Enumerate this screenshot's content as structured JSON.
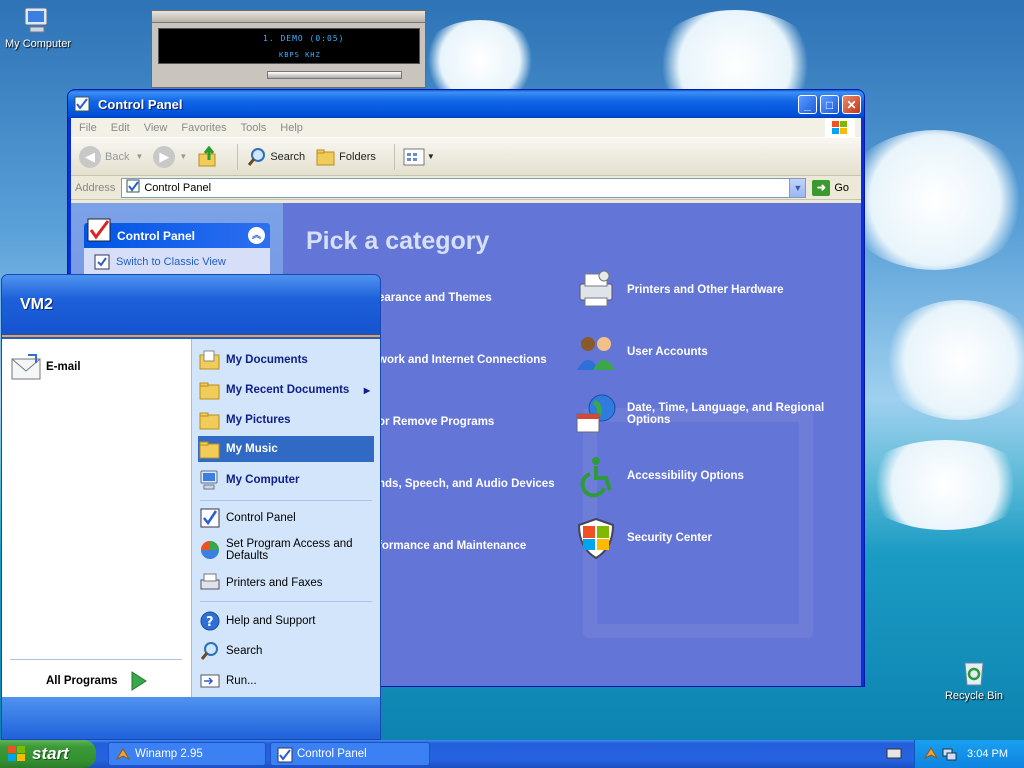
{
  "desktop": {
    "icons": [
      {
        "label": "My Computer",
        "icon": "computer-icon"
      },
      {
        "label": "Recycle Bin",
        "icon": "recycle-bin-icon"
      }
    ]
  },
  "winamp": {
    "track": "1. DEMO (0:05)",
    "kbps": "KBPS   KHZ"
  },
  "control_panel": {
    "title": "Control Panel",
    "menu": [
      "File",
      "Edit",
      "View",
      "Favorites",
      "Tools",
      "Help"
    ],
    "toolbar": {
      "back": "Back",
      "search": "Search",
      "folders": "Folders"
    },
    "address_label": "Address",
    "address_value": "Control Panel",
    "go_label": "Go",
    "left_pane": {
      "header": "Control Panel",
      "link": "Switch to Classic View"
    },
    "heading": "Pick a category",
    "categories_left": [
      "earance and Themes",
      "work and Internet Connections",
      "or Remove Programs",
      "nds, Speech, and Audio Devices",
      "formance and Maintenance"
    ],
    "categories_right": [
      "Printers and Other Hardware",
      "User Accounts",
      "Date, Time, Language, and Regional Options",
      "Accessibility Options",
      "Security Center"
    ]
  },
  "start_menu": {
    "user": "VM2",
    "pinned": [
      {
        "label": "E-mail"
      }
    ],
    "all_programs": "All Programs",
    "right_items": {
      "my_documents": "My Documents",
      "my_recent_documents": "My Recent Documents",
      "my_pictures": "My Pictures",
      "my_music": "My Music",
      "my_computer": "My Computer",
      "control_panel": "Control Panel",
      "set_program_access": "Set Program Access and Defaults",
      "printers_faxes": "Printers and Faxes",
      "help_support": "Help and Support",
      "search": "Search",
      "run": "Run..."
    }
  },
  "taskbar": {
    "start_label": "start",
    "tasks": [
      "Winamp 2.95",
      "Control Panel"
    ],
    "clock": "3:04 PM"
  }
}
